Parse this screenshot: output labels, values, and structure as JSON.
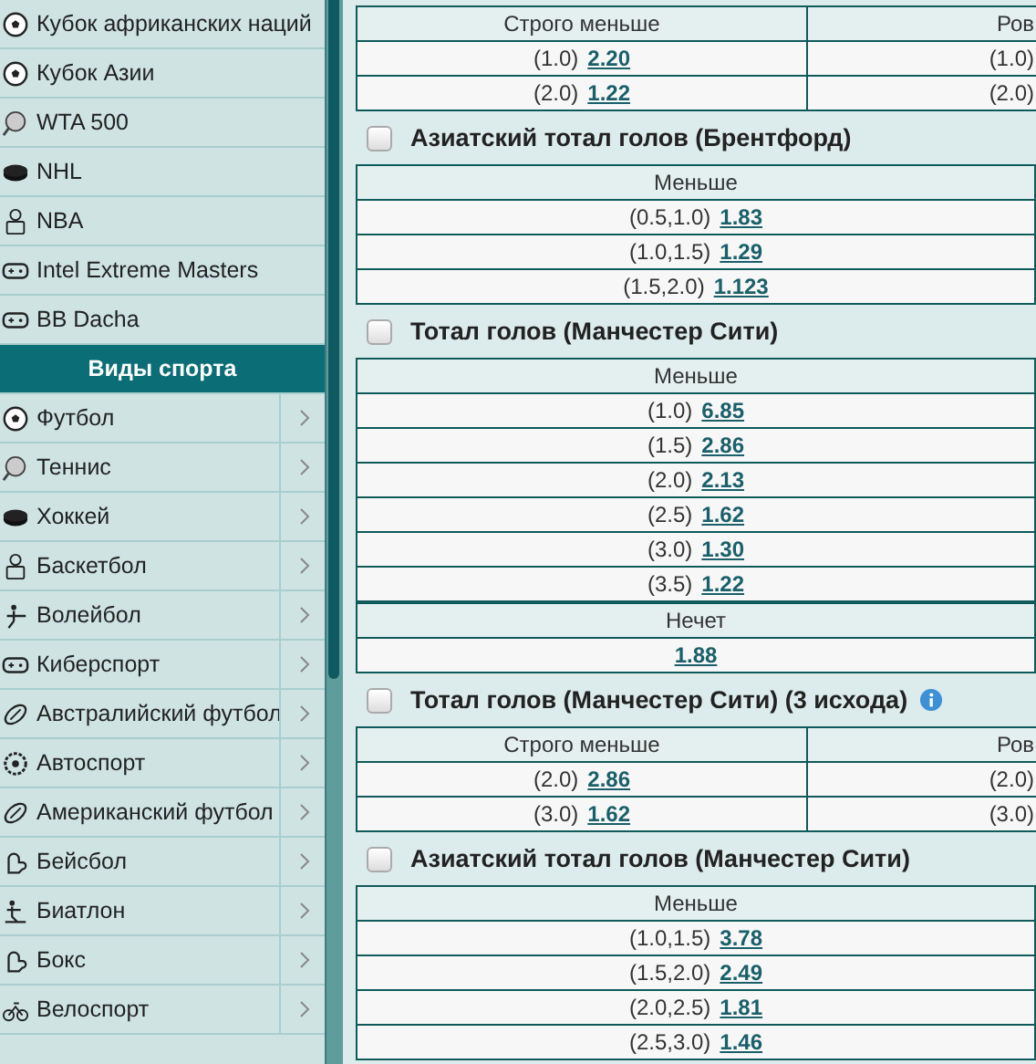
{
  "sidebar": {
    "top_items": [
      {
        "kind": "soccer",
        "label": "Кубок африканских наций"
      },
      {
        "kind": "soccer",
        "label": "Кубок Азии"
      },
      {
        "kind": "tennis",
        "label": "WTA 500"
      },
      {
        "kind": "puck",
        "label": "NHL"
      },
      {
        "kind": "player",
        "label": "NBA"
      },
      {
        "kind": "gamepad",
        "label": "Intel Extreme Masters"
      },
      {
        "kind": "gamepad",
        "label": "BB Dacha"
      }
    ],
    "section_title": "Виды спорта",
    "sports": [
      {
        "kind": "soccer",
        "label": "Футбол"
      },
      {
        "kind": "tennis",
        "label": "Теннис"
      },
      {
        "kind": "puck",
        "label": "Хоккей"
      },
      {
        "kind": "player",
        "label": "Баскетбол"
      },
      {
        "kind": "volley",
        "label": "Волейбол"
      },
      {
        "kind": "gamepad",
        "label": "Киберспорт"
      },
      {
        "kind": "oval",
        "label": "Австралийский футбол"
      },
      {
        "kind": "wheel",
        "label": "Автоспорт"
      },
      {
        "kind": "oval",
        "label": "Американский футбол"
      },
      {
        "kind": "glove",
        "label": "Бейсбол"
      },
      {
        "kind": "skier",
        "label": "Биатлон"
      },
      {
        "kind": "glove",
        "label": "Бокс"
      },
      {
        "kind": "bike",
        "label": "Велоспорт"
      }
    ]
  },
  "markets": [
    {
      "groups": [
        {
          "columns": [
            {
              "header": "Строго меньше",
              "cells": [
                {
                  "param": "(1.0)",
                  "odd": "2.20"
                },
                {
                  "param": "(2.0)",
                  "odd": "1.22"
                }
              ]
            },
            {
              "header": "Ров",
              "cells": [
                {
                  "param": "(1.0)"
                },
                {
                  "param": "(2.0)"
                }
              ]
            }
          ]
        }
      ]
    },
    {
      "title": "Азиатский тотал голов (Брентфорд)",
      "checked": false,
      "groups": [
        {
          "columns": [
            {
              "header": "Меньше",
              "cells": [
                {
                  "param": "(0.5,1.0)",
                  "odd": "1.83"
                },
                {
                  "param": "(1.0,1.5)",
                  "odd": "1.29"
                },
                {
                  "param": "(1.5,2.0)",
                  "odd": "1.123"
                }
              ]
            }
          ]
        }
      ]
    },
    {
      "title": "Тотал голов (Манчестер Сити)",
      "checked": false,
      "groups": [
        {
          "columns": [
            {
              "header": "Меньше",
              "cells": [
                {
                  "param": "(1.0)",
                  "odd": "6.85"
                },
                {
                  "param": "(1.5)",
                  "odd": "2.86"
                },
                {
                  "param": "(2.0)",
                  "odd": "2.13"
                },
                {
                  "param": "(2.5)",
                  "odd": "1.62"
                },
                {
                  "param": "(3.0)",
                  "odd": "1.30"
                },
                {
                  "param": "(3.5)",
                  "odd": "1.22"
                }
              ]
            }
          ]
        },
        {
          "columns": [
            {
              "header": "Нечет",
              "cells": [
                {
                  "odd": "1.88"
                }
              ]
            }
          ]
        }
      ]
    },
    {
      "title": "Тотал голов (Манчестер Сити) (3 исхода)",
      "checked": false,
      "info": true,
      "groups": [
        {
          "columns": [
            {
              "header": "Строго меньше",
              "cells": [
                {
                  "param": "(2.0)",
                  "odd": "2.86"
                },
                {
                  "param": "(3.0)",
                  "odd": "1.62"
                }
              ]
            },
            {
              "header": "Ров",
              "cells": [
                {
                  "param": "(2.0)"
                },
                {
                  "param": "(3.0)"
                }
              ]
            }
          ]
        }
      ]
    },
    {
      "title": "Азиатский тотал голов (Манчестер Сити)",
      "checked": false,
      "groups": [
        {
          "columns": [
            {
              "header": "Меньше",
              "cells": [
                {
                  "param": "(1.0,1.5)",
                  "odd": "3.78"
                },
                {
                  "param": "(1.5,2.0)",
                  "odd": "2.49"
                },
                {
                  "param": "(2.0,2.5)",
                  "odd": "1.81"
                },
                {
                  "param": "(2.5,3.0)",
                  "odd": "1.46"
                }
              ]
            }
          ]
        }
      ]
    }
  ]
}
